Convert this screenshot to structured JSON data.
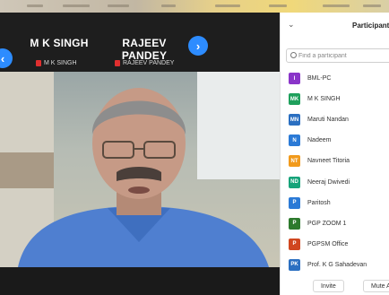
{
  "gallery": {
    "thumbs": [
      {
        "name": "M K SINGH",
        "label": "M K SINGH"
      },
      {
        "name": "RAJEEV PANDEY",
        "label": "RAJEEV PANDEY"
      }
    ],
    "prev_arrow": "‹",
    "next_arrow": "›"
  },
  "panel": {
    "title": "Participants",
    "collapse_glyph": "⌄",
    "search_placeholder": "Find a participant",
    "participants": [
      {
        "initials": "I",
        "name": "BML-PC",
        "color": "#8a35c9"
      },
      {
        "initials": "MK",
        "name": "M K SINGH",
        "color": "#1fa05c"
      },
      {
        "initials": "MN",
        "name": "Maruti Nandan",
        "color": "#2b6fc1"
      },
      {
        "initials": "N",
        "name": "Nadeem",
        "color": "#2b7ad6"
      },
      {
        "initials": "NT",
        "name": "Navneet Titoria",
        "color": "#f19a1c"
      },
      {
        "initials": "ND",
        "name": "Neeraj Dwivedi",
        "color": "#17a37a"
      },
      {
        "initials": "P",
        "name": "Paritosh",
        "color": "#2b7ad6"
      },
      {
        "initials": "P",
        "name": "PGP ZOOM 1",
        "color": "#2d7a2d"
      },
      {
        "initials": "P",
        "name": "PGPSM Office",
        "color": "#d0461f"
      },
      {
        "initials": "PK",
        "name": "Prof. K G Sahadevan",
        "color": "#2b6fc1"
      }
    ],
    "invite_label": "Invite",
    "mute_all_label": "Mute A"
  }
}
